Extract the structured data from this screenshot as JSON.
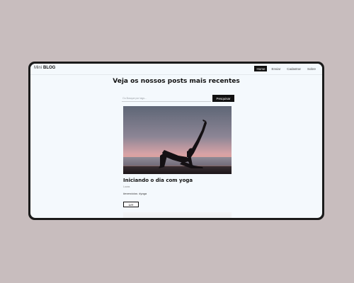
{
  "brand": {
    "light": "Mini",
    "bold": "BLOG"
  },
  "nav": {
    "items": [
      {
        "label": "Home",
        "active": true
      },
      {
        "label": "Enviar",
        "active": false
      },
      {
        "label": "Cadastrar",
        "active": false
      },
      {
        "label": "Sobre",
        "active": false
      }
    ]
  },
  "main": {
    "title": "Veja os nossos posts mais recentes",
    "search": {
      "placeholder": "Ou Busque por tags...",
      "button_label": "Pesquisar"
    }
  },
  "posts": [
    {
      "image": "yoga-silhouette-sunset",
      "title": "Iniciando o dia com yoga",
      "author": "Lucas",
      "tags": [
        "#exercícios",
        "#yoga"
      ],
      "read_label": "Ler"
    }
  ],
  "colors": {
    "page_background": "#c8bdbe",
    "device_frame": "#1b1b1b",
    "screen_background": "#f4f9fd",
    "accent": "#111111"
  }
}
